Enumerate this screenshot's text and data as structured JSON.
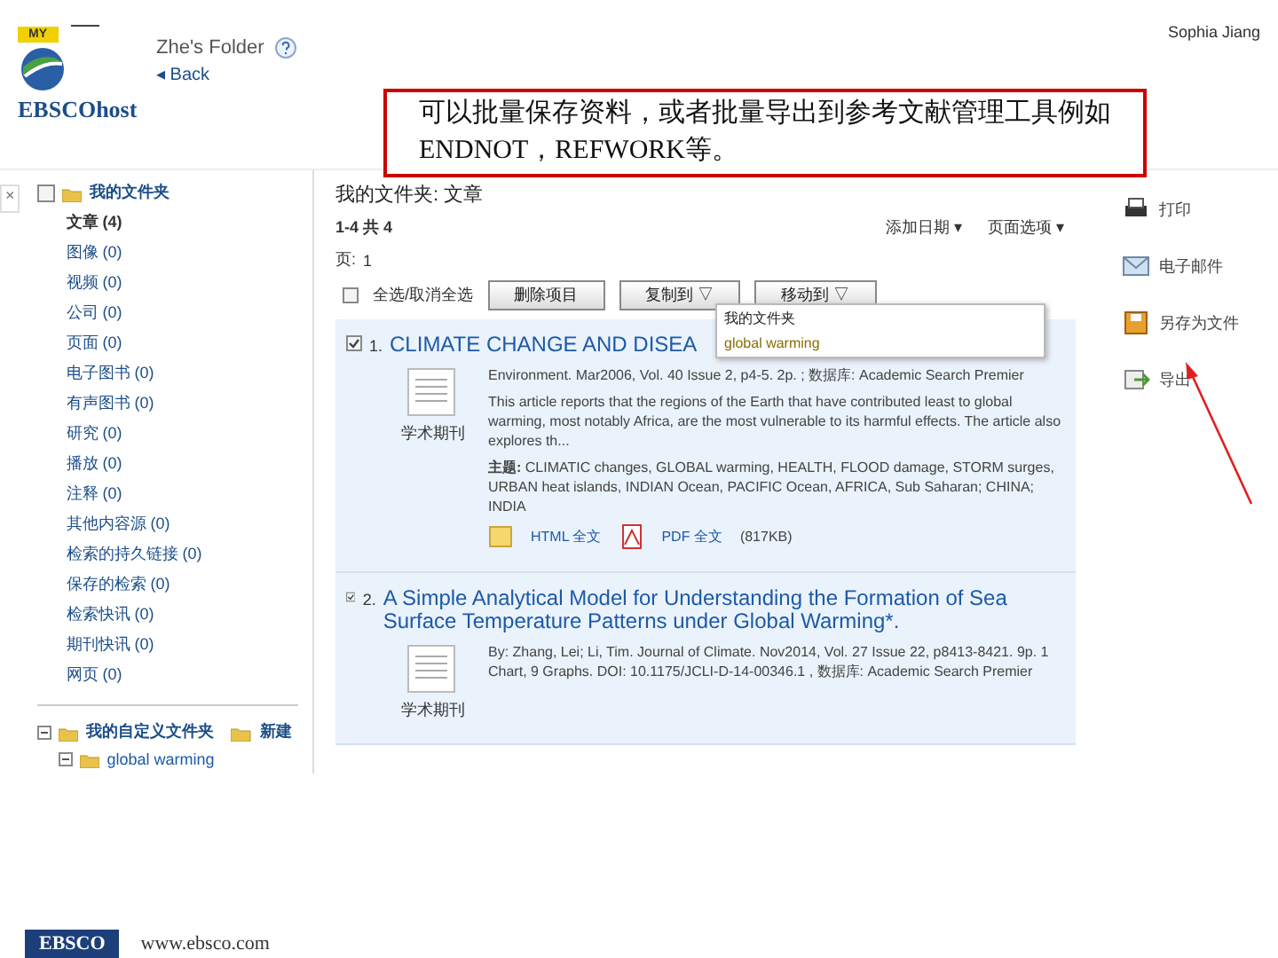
{
  "header": {
    "badge": "MY",
    "brand": "EBSCOhost",
    "folder_title": "Zhe's Folder",
    "back_link": "◂ Back",
    "user_name": "Sophia Jiang"
  },
  "annotation": {
    "text": "可以批量保存资料，或者批量导出到参考文献管理工具例如ENDNOT，REFWORK等。"
  },
  "sidebar": {
    "close_tab": "×",
    "folder": "我的文件夹",
    "items": [
      {
        "label": "文章",
        "count": "(4)",
        "selected": true
      },
      {
        "label": "图像",
        "count": "(0)",
        "selected": false
      },
      {
        "label": "视频",
        "count": "(0)",
        "selected": false
      },
      {
        "label": "公司",
        "count": "(0)",
        "selected": false
      },
      {
        "label": "页面",
        "count": "(0)",
        "selected": false
      },
      {
        "label": "电子图书",
        "count": "(0)",
        "selected": false
      },
      {
        "label": "有声图书",
        "count": "(0)",
        "selected": false
      },
      {
        "label": "研究",
        "count": "(0)",
        "selected": false
      },
      {
        "label": "播放",
        "count": "(0)",
        "selected": false
      },
      {
        "label": "注释",
        "count": "(0)",
        "selected": false
      },
      {
        "label": "其他内容源",
        "count": "(0)",
        "selected": false
      },
      {
        "label": "检索的持久链接",
        "count": "(0)",
        "selected": false
      },
      {
        "label": "保存的检索",
        "count": "(0)",
        "selected": false
      },
      {
        "label": "检索快讯",
        "count": "(0)",
        "selected": false
      },
      {
        "label": "期刊快讯",
        "count": "(0)",
        "selected": false
      },
      {
        "label": "网页",
        "count": "(0)",
        "selected": false
      }
    ],
    "custom_folders": "我的自定义文件夹",
    "new_button": "新建",
    "custom_items": [
      {
        "label": "global warming"
      }
    ]
  },
  "main": {
    "heading": "我的文件夹: 文章",
    "range": "1-4 共 4",
    "page_label": "页:",
    "page": "1",
    "sort": "添加日期 ▾",
    "page_options": "页面选项 ▾",
    "select_all": "全选/取消全选",
    "select_all_checked": false,
    "delete": "删除项目",
    "copy": "复制到 ▽",
    "move": "移动到 ▽",
    "move_menu": [
      {
        "label": "我的文件夹"
      },
      {
        "label": "global warming"
      }
    ],
    "results": [
      {
        "number": "1.",
        "title": "CLIMATE CHANGE AND DISEA",
        "checked": true,
        "type_label": "学术期刊",
        "source": "Environment. Mar2006, Vol. 40 Issue 2, p4-5. 2p. ; 数据库: Academic Search Premier",
        "abstract": "This article reports that the regions of the Earth that have contributed least to global warming, most notably Africa, are the most vulnerable to its harmful effects. The article also explores th...",
        "subjects_label": "主题:",
        "subjects": "CLIMATIC changes, GLOBAL warming, HEALTH, FLOOD damage, STORM surges, URBAN heat islands, INDIAN Ocean, PACIFIC Ocean, AFRICA, Sub Saharan; CHINA; INDIA",
        "links": [
          {
            "kind": "html",
            "label": "HTML 全文"
          },
          {
            "kind": "pdf",
            "label": "PDF 全文",
            "size": "(817KB)"
          }
        ]
      },
      {
        "number": "2.",
        "title": "A Simple Analytical Model for Understanding the Formation of Sea Surface Temperature Patterns under Global Warming*.",
        "checked": true,
        "type_label": "学术期刊",
        "source": "By: Zhang, Lei; Li, Tim. Journal of Climate. Nov2014, Vol. 27 Issue 22, p8413-8421. 9p. 1 Chart, 9 Graphs. DOI: 10.1175/JCLI-D-14-00346.1 , 数据库: Academic Search Premier"
      }
    ]
  },
  "tools": [
    {
      "kind": "print",
      "label": "打印"
    },
    {
      "kind": "email",
      "label": "电子邮件"
    },
    {
      "kind": "save",
      "label": "另存为文件"
    },
    {
      "kind": "export",
      "label": "导出"
    }
  ],
  "footer": {
    "logo": "EBSCO",
    "url": "www.ebsco.com"
  }
}
